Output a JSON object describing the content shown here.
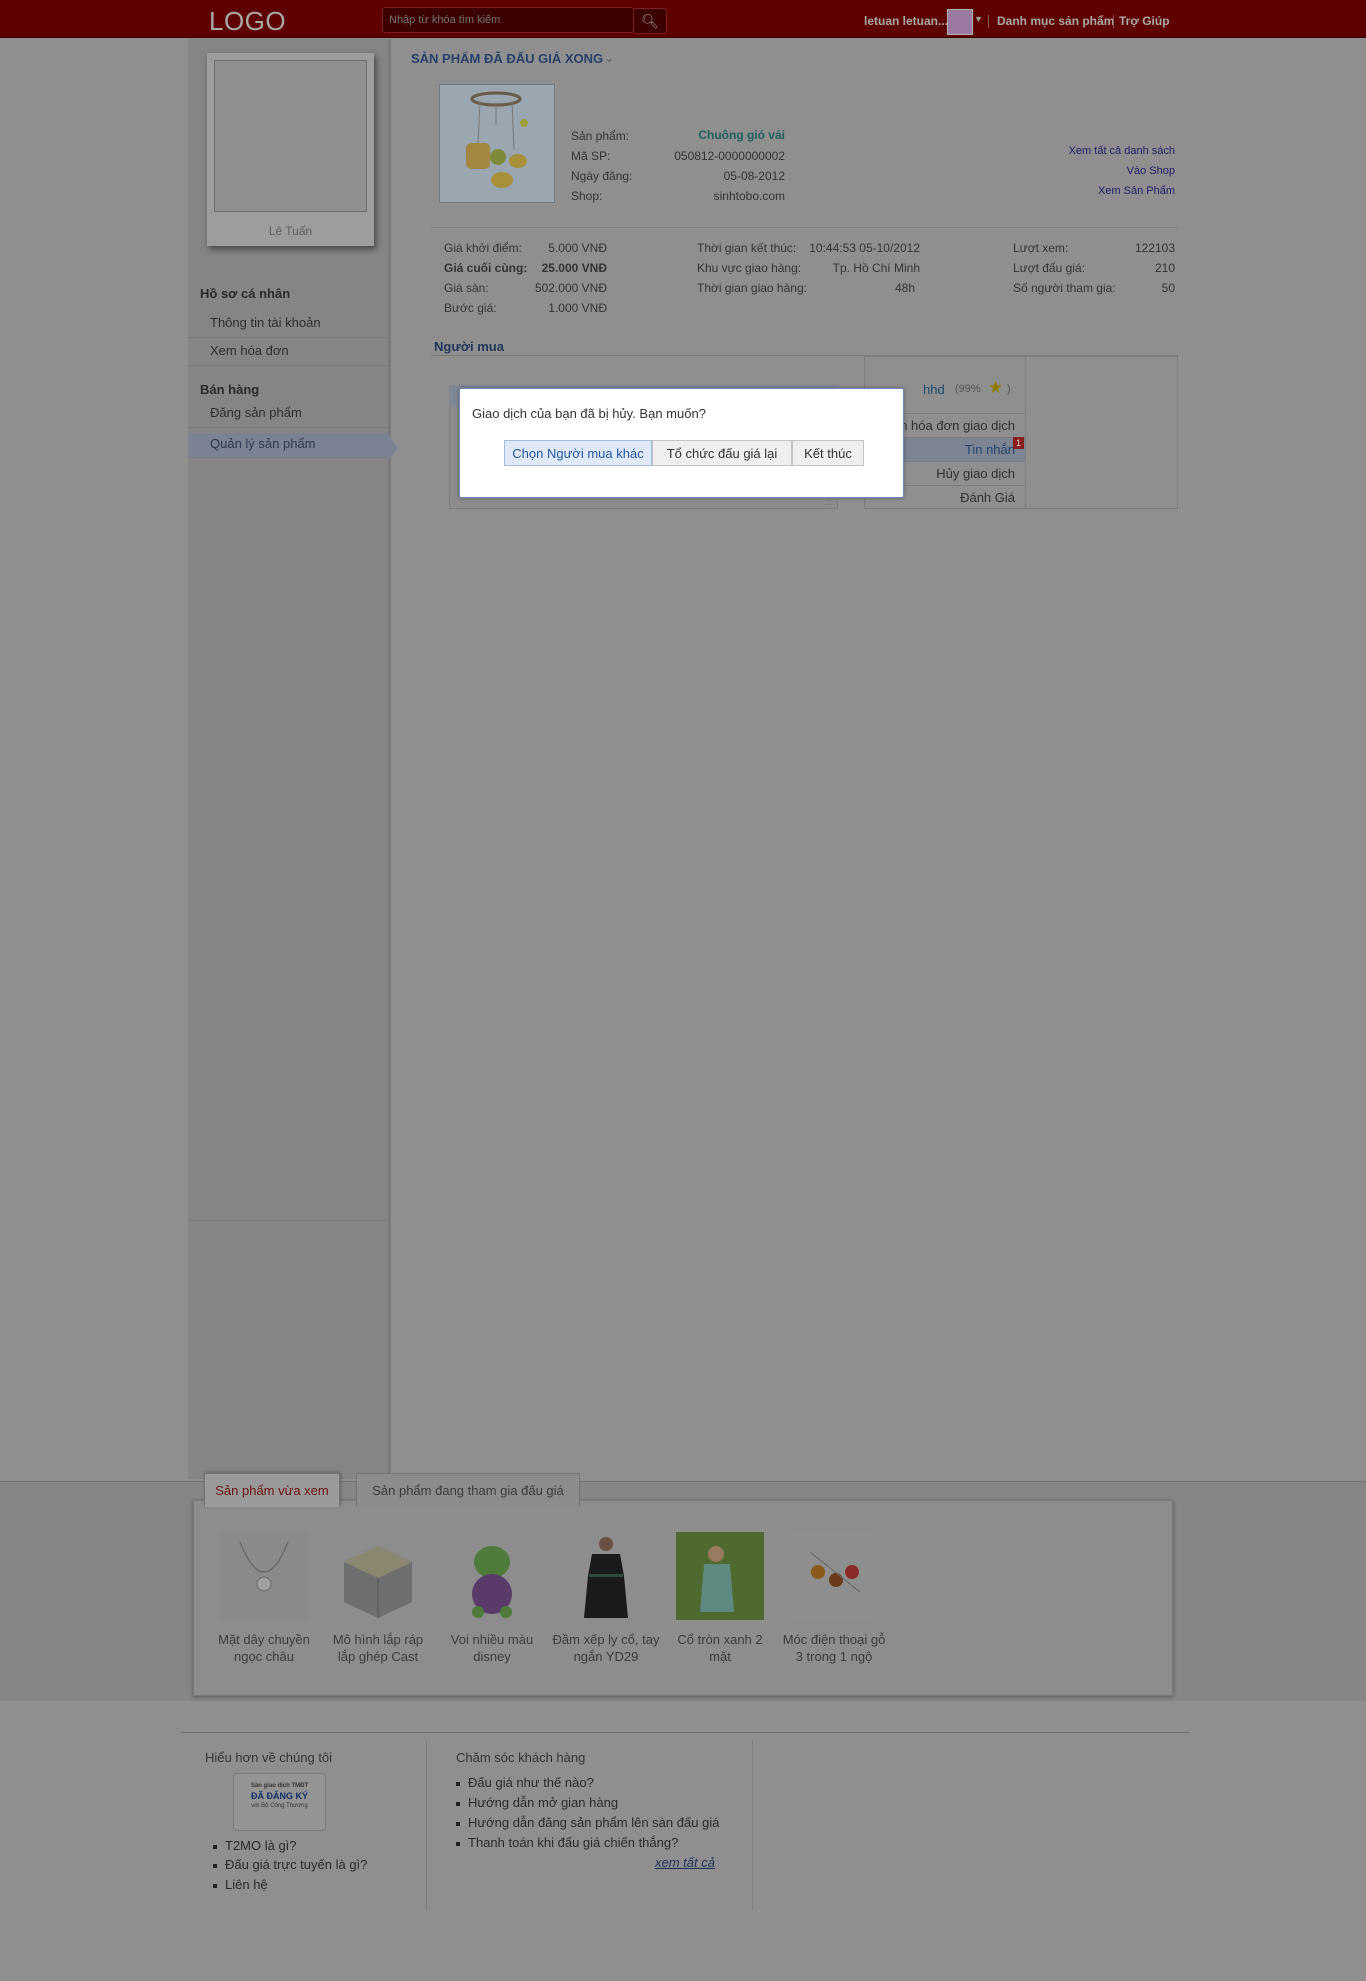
{
  "header": {
    "logo": "LOGO",
    "search_placeholder": "Nhập từ khóa tìm kiếm",
    "user_name": "letuan letuan...",
    "nav_categories": "Danh mục sản phẩm",
    "nav_help": "Trợ Giúp"
  },
  "sidebar": {
    "profile_name": "Lê Tuấn",
    "profile_section": "Hồ sơ cá nhân",
    "items_profile": [
      "Thông tin tài khoản",
      "Xem hóa đơn"
    ],
    "selling_section": "Bán hàng",
    "items_selling": [
      "Đăng sản phẩm",
      "Quản lý sản phẩm"
    ]
  },
  "main": {
    "section_title": "SẢN PHẨM ĐÃ ĐẤU GIÁ XONG",
    "product": {
      "label_name": "Sản phẩm:",
      "name": "Chuông gió vải",
      "label_code": "Mã SP:",
      "code": "050812-0000000002",
      "label_date": "Ngày đăng:",
      "date": "05-08-2012",
      "label_shop": "Shop:",
      "shop": "sinhtobo.com"
    },
    "links": [
      "Xem tất cả danh sách",
      "Vào Shop",
      "Xem Sản Phẩm"
    ],
    "prices": [
      {
        "label": "Giá khởi điểm:",
        "value": "5.000 VNĐ"
      },
      {
        "label": "Giá cuối cùng:",
        "value": "25.000 VNĐ"
      },
      {
        "label": "Giá sàn:",
        "value": "502.000 VNĐ"
      },
      {
        "label": "Bước giá:",
        "value": "1.000 VNĐ"
      }
    ],
    "delivery": [
      {
        "label": "Thời gian kết thúc:",
        "value": "10:44:53 05-10/2012"
      },
      {
        "label": "Khu vực giao hàng:",
        "value": "Tp. Hồ Chí Minh"
      },
      {
        "label": "Thời gian giao hàng:",
        "value": "48h"
      }
    ],
    "stats": [
      {
        "label": "Lượt xem:",
        "value": "122103"
      },
      {
        "label": "Lượt đấu giá:",
        "value": "210"
      },
      {
        "label": "Số người tham gia:",
        "value": "50"
      }
    ],
    "buyers_title": "Người mua",
    "buyer": {
      "name": "hhd",
      "rating_open": "(99%",
      "rating_close": ")"
    },
    "actions": [
      "n hóa đơn giao dịch",
      "Tin nhắn",
      "Hủy giao dịch",
      "Đánh Giá"
    ],
    "message_badge": "1"
  },
  "dialog": {
    "text": "Giao dịch của bạn đã bị hủy. Bạn muốn?",
    "btn_other": "Chọn Người mua khác",
    "btn_relist": "Tổ chức đấu giá lại",
    "btn_end": "Kết thúc"
  },
  "bottom": {
    "tab_recent": "Sản phẩm vừa xem",
    "tab_bidding": "Sản phẩm đang tham gia đấu giá",
    "products": [
      {
        "name": "Mặt dây chuyền ngọc châu"
      },
      {
        "name": "Mô hình lắp ráp lắp ghép Cast"
      },
      {
        "name": "Voi nhiều màu disney"
      },
      {
        "name": "Đầm xếp ly cổ, tay ngắn YD29"
      },
      {
        "name": "Cổ tròn xanh 2 mặt"
      },
      {
        "name": "Móc điện thoại gỗ 3 trong 1 ngộ"
      }
    ]
  },
  "footer": {
    "about_title": "Hiểu hơn về chúng tôi",
    "badge": {
      "line1": "Sàn giao dịch TMĐT",
      "line2": "ĐÃ ĐĂNG KÝ",
      "line3": "với Bộ Công Thương"
    },
    "about_links": [
      "T2MO là gì?",
      "Đấu giá trực tuyến là gì?",
      "Liên hệ"
    ],
    "care_title": "Chăm sóc khách hàng",
    "care_links": [
      "Đấu giá như thế nào?",
      "Hướng dẫn mở gian hàng",
      "Hướng dẫn đăng sản phẩm lên sàn đấu giá",
      "Thanh toán khi đấu giá chiến thắng?"
    ],
    "see_all": "xem tất cả"
  }
}
